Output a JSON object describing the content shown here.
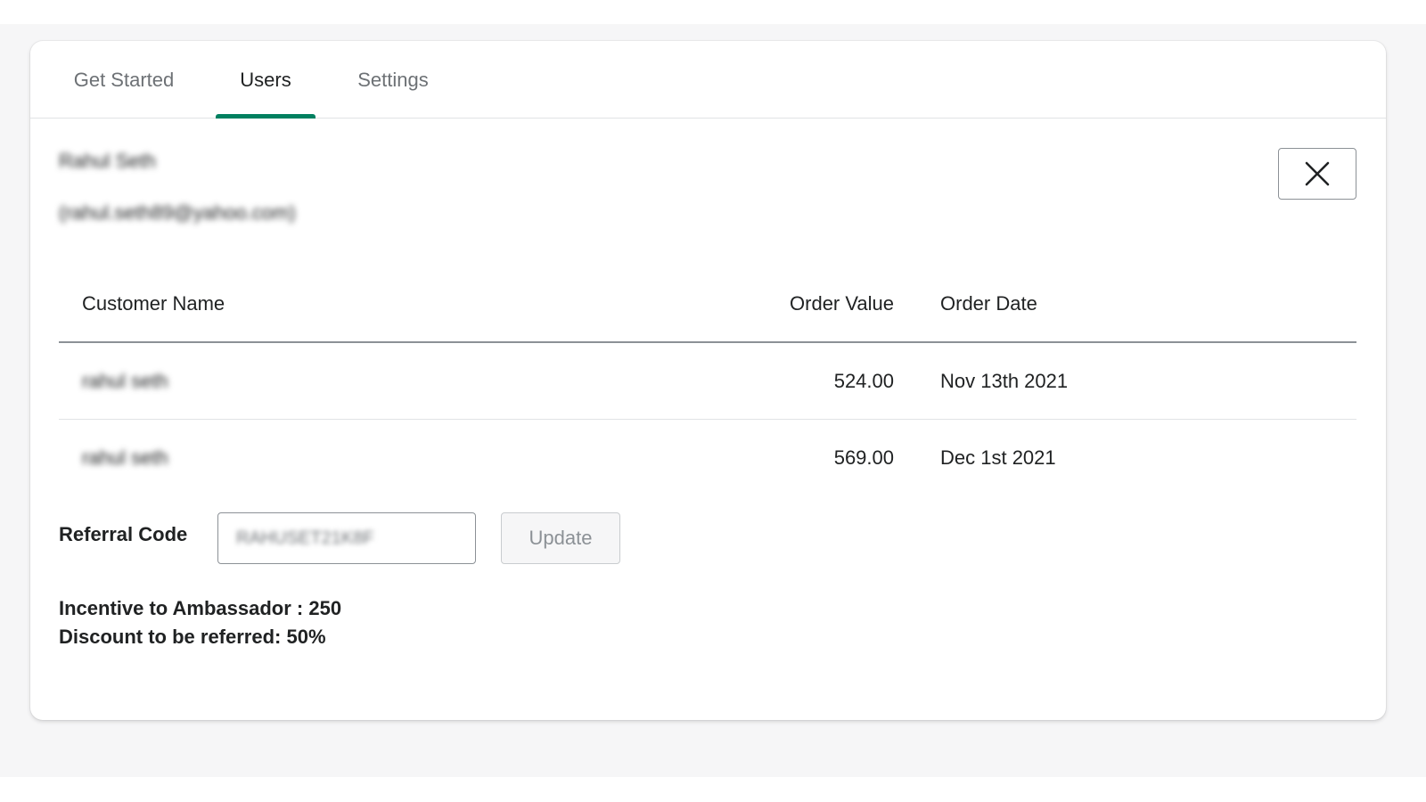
{
  "tabs": [
    {
      "label": "Get Started"
    },
    {
      "label": "Users"
    },
    {
      "label": "Settings"
    }
  ],
  "user": {
    "name": "Rahul Seth",
    "email": "(rahul.seth89@yahoo.com)"
  },
  "table": {
    "headers": {
      "customer_name": "Customer Name",
      "order_value": "Order Value",
      "order_date": "Order Date"
    },
    "rows": [
      {
        "customer_name": "rahul seth",
        "order_value": "524.00",
        "order_date": "Nov 13th 2021"
      },
      {
        "customer_name": "rahul seth",
        "order_value": "569.00",
        "order_date": "Dec 1st 2021"
      }
    ]
  },
  "referral": {
    "label": "Referral Code",
    "code": "RAHUSET21K8F",
    "update_label": "Update"
  },
  "incentives": {
    "ambassador": "Incentive to Ambassador : 250",
    "referred": "Discount to be referred: 50%"
  },
  "colors": {
    "accent": "#008060"
  },
  "icons": {
    "close": "close-icon"
  }
}
